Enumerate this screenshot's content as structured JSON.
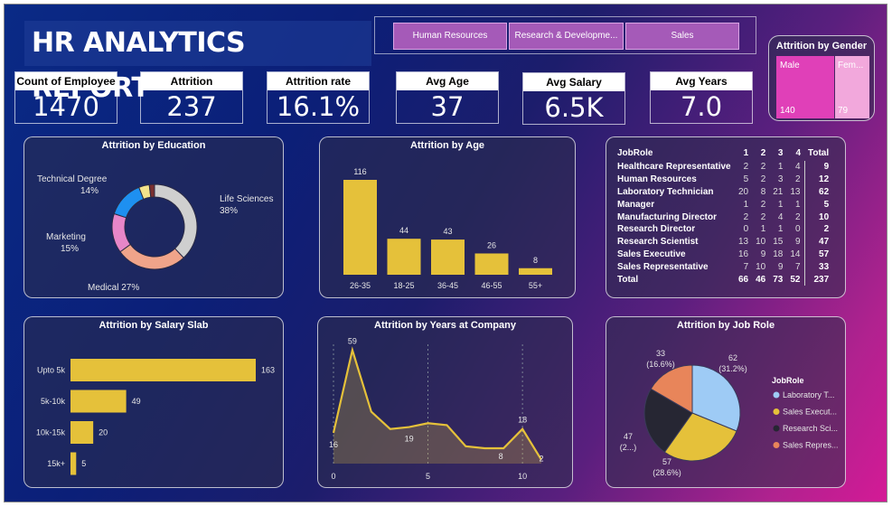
{
  "header": {
    "title": "HR ANALYTICS REPORT"
  },
  "slicer": [
    "Human Resources",
    "Research & Developme...",
    "Sales"
  ],
  "kpis": [
    {
      "label": "Count of Employee",
      "value": "1470"
    },
    {
      "label": "Attrition",
      "value": "237"
    },
    {
      "label": "Attrition rate",
      "value": "16.1%"
    },
    {
      "label": "Avg Age",
      "value": "37"
    },
    {
      "label": "Avg Salary",
      "value": "6.5K"
    },
    {
      "label": "Avg Years",
      "value": "7.0"
    }
  ],
  "gender": {
    "title": "Attrition by Gender",
    "items": [
      {
        "label": "Male",
        "value": "140",
        "color": "#e040b8"
      },
      {
        "label": "Fem...",
        "value": "79",
        "color": "#f2a8dc"
      }
    ]
  },
  "chart_data": [
    {
      "type": "pie",
      "title": "Attrition by Education",
      "donut": true,
      "slices": [
        {
          "label": "Life Sciences",
          "pct_label": "38%",
          "value": 38,
          "color": "#cfcfcf"
        },
        {
          "label": "Medical",
          "pct_label": "27%",
          "value": 27,
          "color": "#f0a48a"
        },
        {
          "label": "Marketing",
          "pct_label": "15%",
          "value": 15,
          "color": "#e786c8"
        },
        {
          "label": "Technical Degree",
          "pct_label": "14%",
          "value": 14,
          "color": "#1e90f0"
        },
        {
          "label": "",
          "pct_label": "",
          "value": 4,
          "color": "#f3e38b"
        },
        {
          "label": "",
          "pct_label": "",
          "value": 2,
          "color": "#7a3030"
        }
      ]
    },
    {
      "type": "bar",
      "title": "Attrition by Age",
      "categories": [
        "26-35",
        "18-25",
        "36-45",
        "46-55",
        "55+"
      ],
      "values": [
        116,
        44,
        43,
        26,
        8
      ],
      "color": "#e5c13a"
    },
    {
      "type": "table",
      "title": "",
      "columns": [
        "JobRole",
        "1",
        "2",
        "3",
        "4",
        "Total"
      ],
      "rows": [
        [
          "Healthcare Representative",
          "2",
          "2",
          "1",
          "4",
          "9"
        ],
        [
          "Human Resources",
          "5",
          "2",
          "3",
          "2",
          "12"
        ],
        [
          "Laboratory Technician",
          "20",
          "8",
          "21",
          "13",
          "62"
        ],
        [
          "Manager",
          "1",
          "2",
          "1",
          "1",
          "5"
        ],
        [
          "Manufacturing Director",
          "2",
          "2",
          "4",
          "2",
          "10"
        ],
        [
          "Research Director",
          "0",
          "1",
          "1",
          "0",
          "2"
        ],
        [
          "Research Scientist",
          "13",
          "10",
          "15",
          "9",
          "47"
        ],
        [
          "Sales Executive",
          "16",
          "9",
          "18",
          "14",
          "57"
        ],
        [
          "Sales Representative",
          "7",
          "10",
          "9",
          "7",
          "33"
        ]
      ],
      "total": [
        "Total",
        "66",
        "46",
        "73",
        "52",
        "237"
      ]
    },
    {
      "type": "bar",
      "orientation": "horizontal",
      "title": "Attrition by Salary Slab",
      "categories": [
        "Upto 5k",
        "5k-10k",
        "10k-15k",
        "15k+"
      ],
      "values": [
        163,
        49,
        20,
        5
      ],
      "color": "#e5c13a"
    },
    {
      "type": "area",
      "title": "Attrition by Years at Company",
      "x": [
        0,
        1,
        2,
        3,
        4,
        5,
        6,
        7,
        8,
        9,
        10,
        11
      ],
      "y": [
        16,
        59,
        27,
        18,
        19,
        21,
        20,
        9,
        8,
        8,
        18,
        2
      ],
      "labeled": [
        {
          "i": 0,
          "t": "16"
        },
        {
          "i": 1,
          "t": "59"
        },
        {
          "i": 4,
          "t": "19"
        },
        {
          "i": 9,
          "t": "8"
        },
        {
          "i": 10,
          "t": "18"
        },
        {
          "i": 11,
          "t": "2"
        }
      ],
      "xticks": [
        "0",
        "5",
        "10"
      ],
      "xtick_values": [
        0,
        5,
        10
      ],
      "ylim": [
        0,
        62
      ],
      "color": "#e5c13a"
    },
    {
      "type": "pie",
      "title": "Attrition by Job Role",
      "legend_title": "JobRole",
      "slices": [
        {
          "label": "Laboratory T...",
          "value": 62,
          "text": "62",
          "pct": "(31.2%)",
          "color": "#9ecbf5"
        },
        {
          "label": "Sales Execut...",
          "value": 57,
          "text": "57",
          "pct": "(28.6%)",
          "color": "#e5c13a"
        },
        {
          "label": "Research Sci...",
          "value": 47,
          "text": "47",
          "pct": "(2...)",
          "color": "#262633"
        },
        {
          "label": "Sales Repres...",
          "value": 33,
          "text": "33",
          "pct": "(16.6%)",
          "color": "#e8855a"
        }
      ]
    }
  ]
}
